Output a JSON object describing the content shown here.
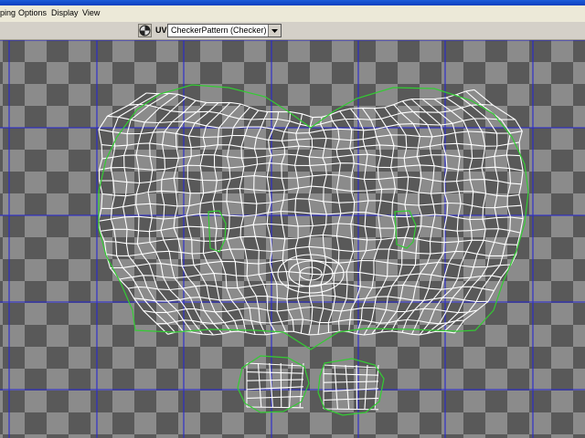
{
  "menubar": {
    "items": [
      "ping",
      "Options",
      "Display",
      "View"
    ]
  },
  "toolbar": {
    "uv_label": "UV",
    "texture_dropdown": "CheckerPattern  (Checker)",
    "shader_icon": "checker-ball-icon"
  },
  "colors": {
    "checker_light": "#8b8b8b",
    "checker_dark": "#595959",
    "grid_line": "#2a2acf",
    "uv_edge": "#ffffff",
    "uv_border": "#33cc33"
  }
}
